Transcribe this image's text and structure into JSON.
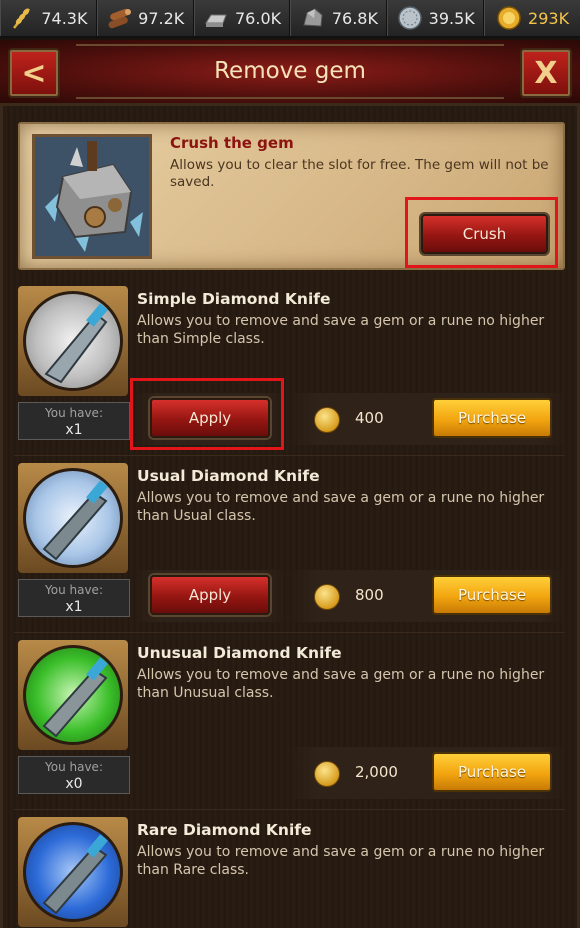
{
  "resources": [
    {
      "icon": "wheat-icon",
      "value": "74.3K"
    },
    {
      "icon": "wood-logs-icon",
      "value": "97.2K"
    },
    {
      "icon": "iron-ingot-icon",
      "value": "76.0K"
    },
    {
      "icon": "stone-icon",
      "value": "76.8K"
    },
    {
      "icon": "silver-coin-icon",
      "value": "39.5K"
    },
    {
      "icon": "gold-coin-icon",
      "value": "293K"
    }
  ],
  "header": {
    "title": "Remove gem",
    "back_label": "<",
    "close_label": "X"
  },
  "crush": {
    "title": "Crush the gem",
    "description": "Allows you to clear the slot for free. The gem will not be saved.",
    "button_label": "Crush"
  },
  "items": [
    {
      "title": "Simple Diamond Knife",
      "description": "Allows you to remove and save a gem or a rune no higher than Simple class.",
      "have_label": "You have:",
      "have_value": "x1",
      "apply_label": "Apply",
      "price": "400",
      "purchase_label": "Purchase",
      "glow_color": "#d8d8d8"
    },
    {
      "title": "Usual Diamond Knife",
      "description": "Allows you to remove and save a gem or a rune no higher than Usual class.",
      "have_label": "You have:",
      "have_value": "x1",
      "apply_label": "Apply",
      "price": "800",
      "purchase_label": "Purchase",
      "glow_color": "#a9c6e8"
    },
    {
      "title": "Unusual Diamond Knife",
      "description": "Allows you to remove and save a gem or a rune no higher than Unusual class.",
      "have_label": "You have:",
      "have_value": "x0",
      "price": "2,000",
      "purchase_label": "Purchase",
      "glow_color": "#3bbf2a"
    },
    {
      "title": "Rare Diamond Knife",
      "description": "Allows you to remove and save a gem or a rune no higher than Rare class.",
      "glow_color": "#2d6bd8"
    }
  ],
  "colors": {
    "accent_red": "#951612",
    "purchase_yellow": "#f2a50f",
    "highlight_box": "#e2151b"
  }
}
